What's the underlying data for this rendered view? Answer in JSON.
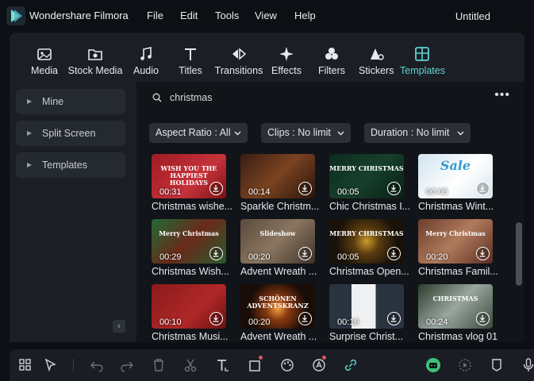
{
  "app": {
    "name": "Wondershare Filmora",
    "project_title": "Untitled"
  },
  "menu": [
    "File",
    "Edit",
    "Tools",
    "View",
    "Help"
  ],
  "toolbar": {
    "tabs": [
      {
        "label": "Media",
        "icon": "media-icon"
      },
      {
        "label": "Stock Media",
        "icon": "stock-media-icon"
      },
      {
        "label": "Audio",
        "icon": "music-note-icon"
      },
      {
        "label": "Titles",
        "icon": "text-t-icon"
      },
      {
        "label": "Transitions",
        "icon": "transitions-icon"
      },
      {
        "label": "Effects",
        "icon": "sparkle-icon"
      },
      {
        "label": "Filters",
        "icon": "filters-icon"
      },
      {
        "label": "Stickers",
        "icon": "stickers-icon"
      },
      {
        "label": "Templates",
        "icon": "templates-icon",
        "active": true
      }
    ],
    "active_color": "#5fd4d0"
  },
  "sidebar": {
    "items": [
      {
        "label": "Mine"
      },
      {
        "label": "Split Screen"
      },
      {
        "label": "Templates"
      }
    ]
  },
  "search": {
    "value": "christmas"
  },
  "filters": [
    {
      "label": "Aspect Ratio : All"
    },
    {
      "label": "Clips : No limit"
    },
    {
      "label": "Duration : No limit"
    }
  ],
  "templates": [
    {
      "title": "Christmas wishe...",
      "duration": "00:31",
      "thumb_text": "WISH YOU THE HAPPIEST HOLIDAYS",
      "bg": "linear-gradient(135deg,#a01b23,#c6323a 60%,#7a1116)"
    },
    {
      "title": "Sparkle Christm...",
      "duration": "00:14",
      "thumb_text": "",
      "bg": "linear-gradient(135deg,#3a1d12,#7a4320 50%,#2a140c)"
    },
    {
      "title": "Chic Christmas I...",
      "duration": "00:05",
      "thumb_text": "MERRY CHRISTMAS",
      "bg": "linear-gradient(135deg,#0d2a1d,#16402c 50%,#0b1f16)"
    },
    {
      "title": "Christmas Wint...",
      "duration": "00:05",
      "thumb_text": "Sale",
      "bg": "linear-gradient(135deg,#cfe3ef,#ffffff 55%,#d8e6ee)"
    },
    {
      "title": "Christmas Wish...",
      "duration": "00:29",
      "thumb_text": "Merry Christmas",
      "bg": "linear-gradient(135deg,#1f6b34,#6a2a1a 50%,#2a5a2f)"
    },
    {
      "title": "Advent Wreath ...",
      "duration": "00:20",
      "thumb_text": "Slideshow",
      "bg": "linear-gradient(135deg,#5a4a3c,#8a7660 50%,#3e3228)"
    },
    {
      "title": "Christmas Open...",
      "duration": "00:05",
      "thumb_text": "MERRY CHRISTMAS",
      "bg": "radial-gradient(circle at 50% 50%,#c89a2a 0,#5a3c10 30%,#1a1208 70%)"
    },
    {
      "title": "Christmas Famil...",
      "duration": "00:20",
      "thumb_text": "Merry Christmas",
      "bg": "linear-gradient(135deg,#6a3e2c,#b07a5c 50%,#5a2c22)"
    },
    {
      "title": "Christmas Musi...",
      "duration": "00:10",
      "thumb_text": "",
      "bg": "linear-gradient(135deg,#8a1a1a,#b02828 60%,#6a1010)"
    },
    {
      "title": "Advent Wreath ...",
      "duration": "00:20",
      "thumb_text": "SCHÖNEN ADVENTSKRANZ",
      "bg": "radial-gradient(circle at 50% 55%,#f0a040 0,#8a3a10 25%,#1a0c06 65%)"
    },
    {
      "title": "Surprise Christ...",
      "duration": "00:16",
      "thumb_text": "",
      "bg": "linear-gradient(90deg,#2a3440,#2a3440 30%,#eef0f2 30%,#eef0f2 62%,#2a3440 62%)"
    },
    {
      "title": "Christmas vlog 01",
      "duration": "00:24",
      "thumb_text": "CHRISTMAS",
      "bg": "linear-gradient(135deg,#2a3d2c,#9aa6a0 50%,#3a4a3c)"
    }
  ]
}
